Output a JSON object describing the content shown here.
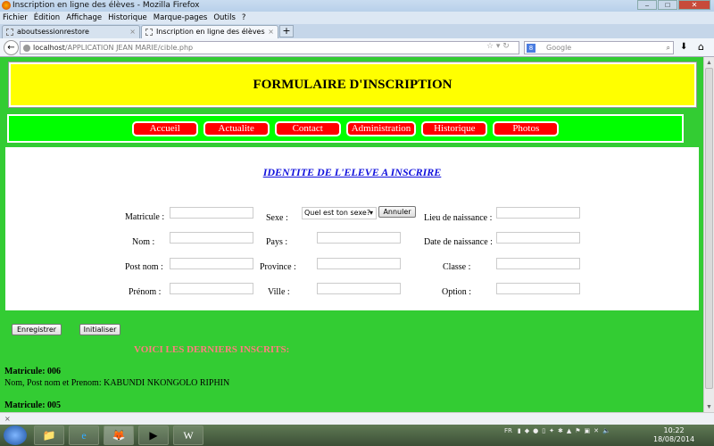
{
  "window": {
    "title": "Inscription en ligne des élèves - Mozilla Firefox"
  },
  "menu": [
    "Fichier",
    "Édition",
    "Affichage",
    "Historique",
    "Marque-pages",
    "Outils",
    "?"
  ],
  "tabs": [
    {
      "label": "aboutsessionrestore"
    },
    {
      "label": "Inscription en ligne des élèves"
    }
  ],
  "url": {
    "host": "localhost",
    "path": "/APPLICATION JEAN MARIE/cible.php"
  },
  "search": {
    "placeholder": "Google"
  },
  "page": {
    "header": "FORMULAIRE D'INSCRIPTION",
    "nav": [
      "Accueil",
      "Actualite",
      "Contact",
      "Administration",
      "Historique",
      "Photos"
    ],
    "form_title": "IDENTITE DE L'ELEVE A INSCRIRE",
    "labels": {
      "matricule": "Matricule :",
      "nom": "Nom :",
      "postnom": "Post nom :",
      "prenom": "Prénom :",
      "sexe": "Sexe :",
      "pays": "Pays :",
      "province": "Province :",
      "ville": "Ville :",
      "lieu": "Lieu de naissance :",
      "date": "Date de naissance :",
      "classe": "Classe :",
      "option": "Option :"
    },
    "sexe_select": "Quel est ton sexe?",
    "annuler": "Annuler",
    "enregistrer": "Enregistrer",
    "initialiser": "Initialiser",
    "latest_title": "VOICI LES DERNIERS INSCRITS:",
    "entries": [
      {
        "matricule": "Matricule: 006",
        "names": "Nom, Post nom et Prenom: KABUNDI NKONGOLO RIPHIN"
      },
      {
        "matricule": "Matricule: 005"
      }
    ]
  },
  "statusbar": {
    "close": "×"
  },
  "taskbar": {
    "lang": "FR",
    "time": "10:22",
    "date": "18/08/2014"
  }
}
